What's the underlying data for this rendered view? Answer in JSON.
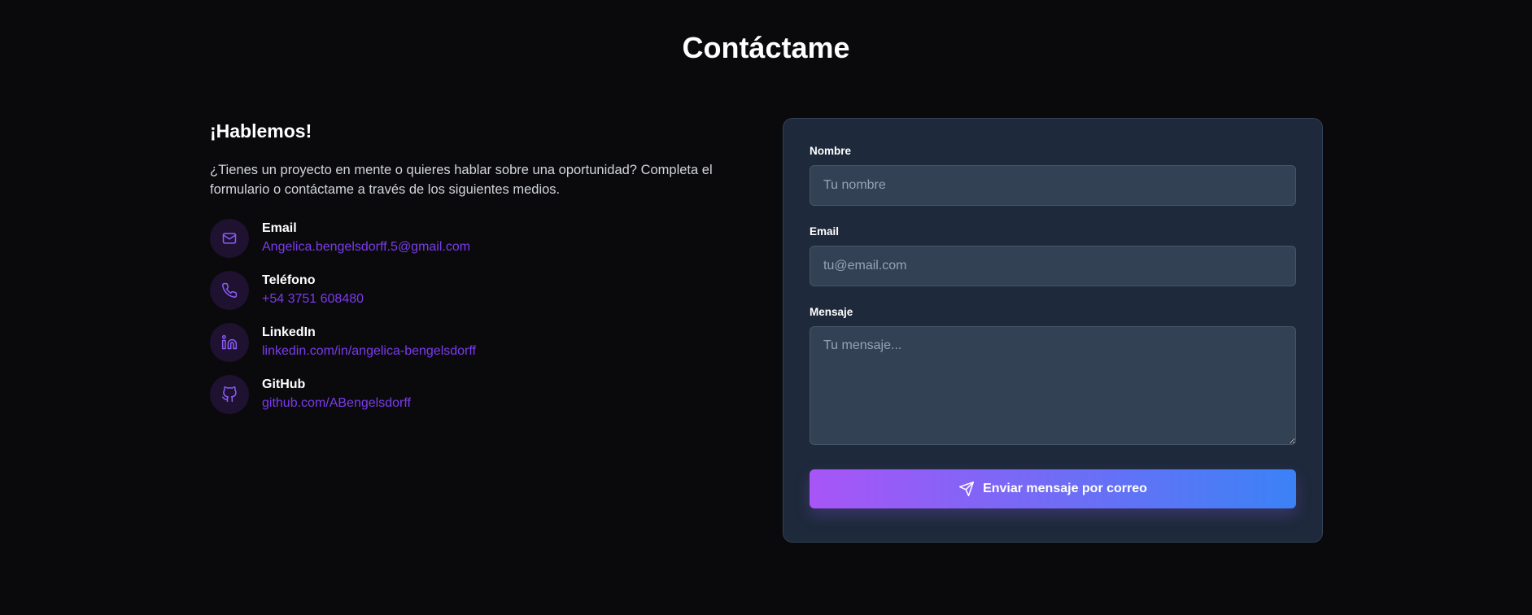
{
  "page": {
    "title": "Contáctame"
  },
  "info": {
    "heading": "¡Hablemos!",
    "intro": "¿Tienes un proyecto en mente o quieres hablar sobre una oportunidad? Completa el formulario o contáctame a través de los siguientes medios.",
    "contacts": [
      {
        "icon": "mail-icon",
        "label": "Email",
        "value": "Angelica.bengelsdorff.5@gmail.com"
      },
      {
        "icon": "phone-icon",
        "label": "Teléfono",
        "value": "+54 3751 608480"
      },
      {
        "icon": "linkedin-icon",
        "label": "LinkedIn",
        "value": "linkedin.com/in/angelica-bengelsdorff"
      },
      {
        "icon": "github-icon",
        "label": "GitHub",
        "value": "github.com/ABengelsdorff"
      }
    ]
  },
  "form": {
    "name_label": "Nombre",
    "name_placeholder": "Tu nombre",
    "email_label": "Email",
    "email_placeholder": "tu@email.com",
    "message_label": "Mensaje",
    "message_placeholder": "Tu mensaje...",
    "submit_label": "Enviar mensaje por correo",
    "submit_icon": "send-icon"
  },
  "colors": {
    "background": "#0a0a0c",
    "card": "#1e293b",
    "input": "#334155",
    "accent_link": "#7c3aed",
    "gradient_start": "#a855f7",
    "gradient_end": "#3b82f6"
  }
}
